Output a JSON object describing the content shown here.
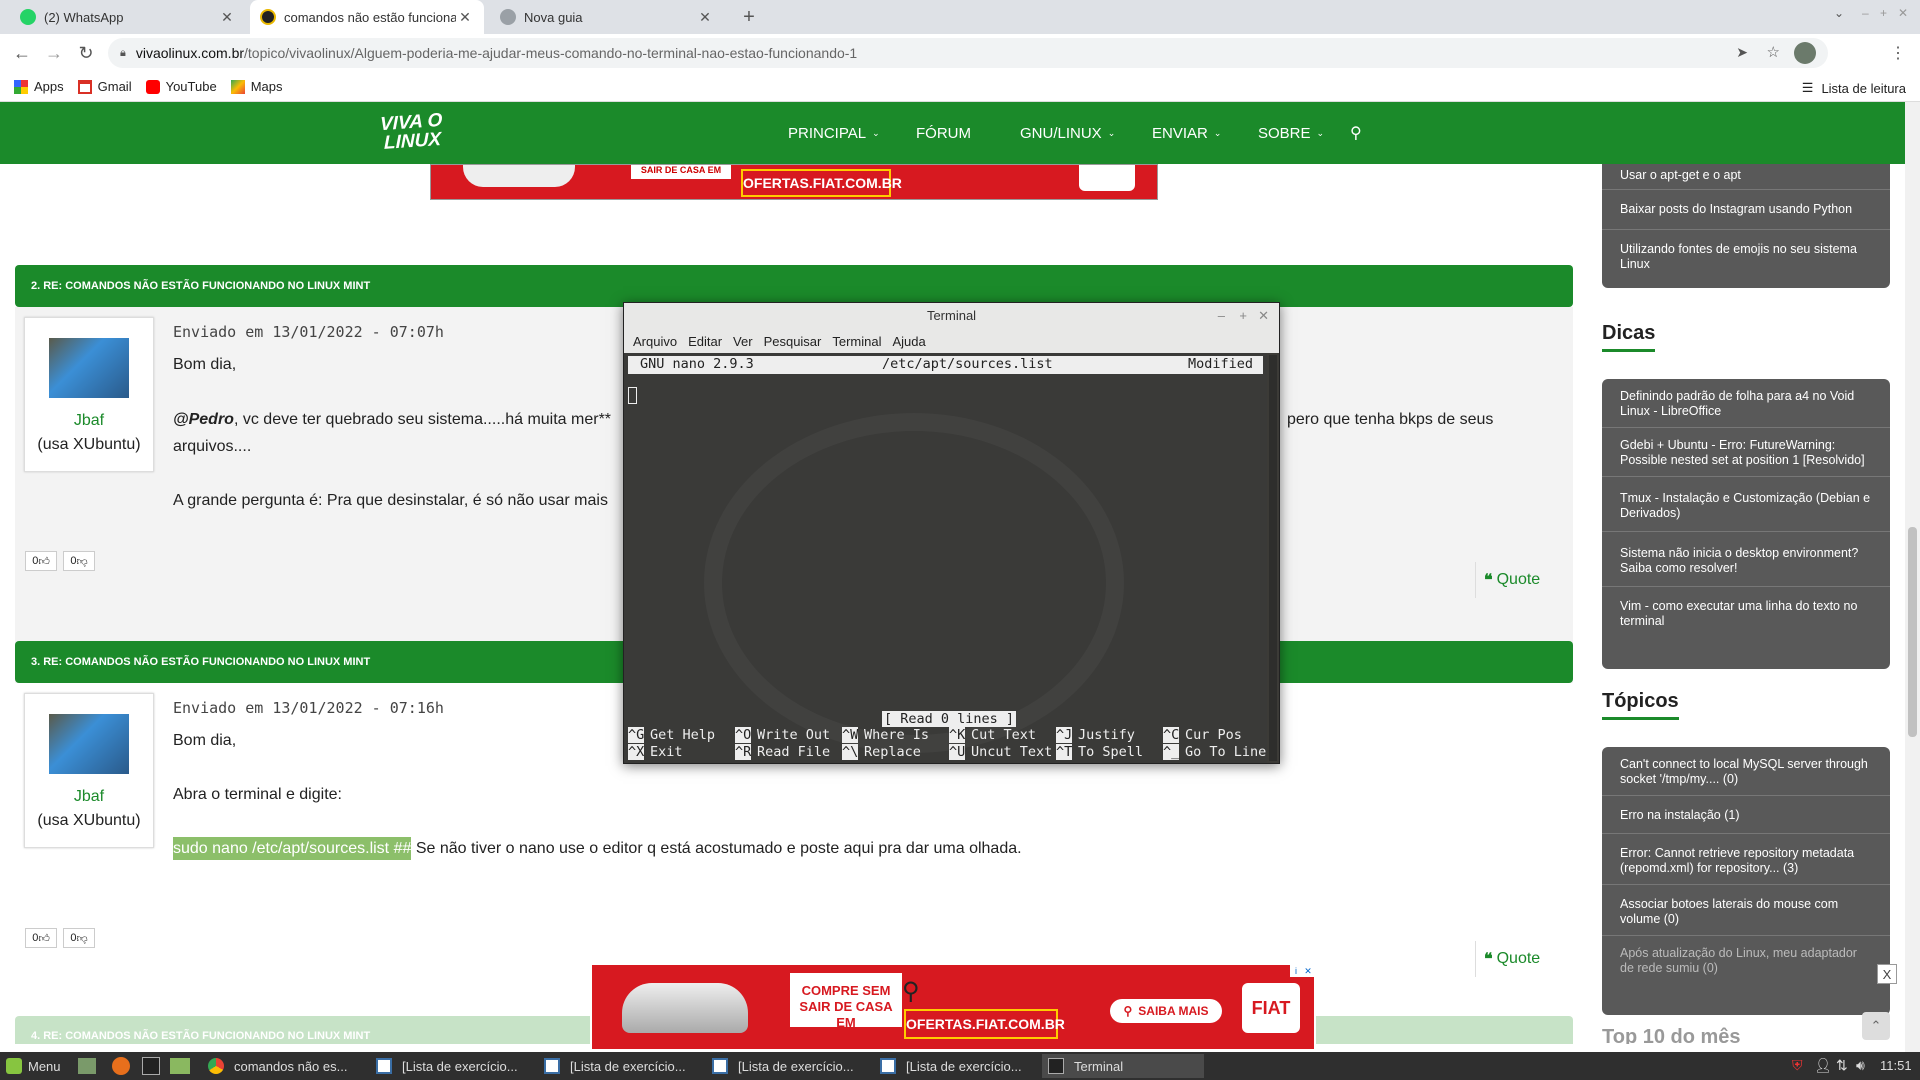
{
  "browser": {
    "tabs": [
      {
        "label": "(2) WhatsApp",
        "active": false
      },
      {
        "label": "comandos não estão funciona",
        "active": true
      },
      {
        "label": "Nova guia",
        "active": false
      }
    ],
    "new_tab": "+",
    "url_domain": "vivaolinux.com.br",
    "url_path": "/topico/vivaolinux/Alguem-poderia-me-ajudar-meus-comando-no-terminal-nao-estao-funcionando-1",
    "bookmarks": [
      "Apps",
      "Gmail",
      "YouTube",
      "Maps"
    ],
    "reading_list": "Lista de leitura"
  },
  "site": {
    "logo_line1": "VIVA O",
    "logo_line2": "LINUX",
    "menu": [
      {
        "label": "PRINCIPAL",
        "caret": "⌄"
      },
      {
        "label": "FÓRUM",
        "caret": ""
      },
      {
        "label": "GNU/LINUX",
        "caret": "⌄"
      },
      {
        "label": "ENVIAR",
        "caret": "⌄"
      },
      {
        "label": "SOBRE",
        "caret": "⌄"
      }
    ],
    "top_ad_text": "OFERTAS.FIAT.COM.BR",
    "top_ad_small": "SAIR DE CASA EM"
  },
  "posts": [
    {
      "header": "2. RE: COMANDOS NÃO ESTÃO FUNCIONANDO NO LINUX MINT",
      "user": "Jbaf",
      "distro": "(usa XUbuntu)",
      "meta": "Enviado em 13/01/2022 - 07:07h",
      "p1": "Bom dia,",
      "mention": "@Pedro",
      "p2a": ", vc deve ter quebrado seu sistema.....há muita mer**",
      "p2b": "pero que tenha bkps de seus",
      "p2c": "arquivos....",
      "p3": "A grande pergunta é: Pra que desinstalar, é só não usar mais",
      "up": "0",
      "down": "0",
      "quote": "Quote"
    },
    {
      "header": "3. RE: COMANDOS NÃO ESTÃO FUNCIONANDO NO LINUX MINT",
      "user": "Jbaf",
      "distro": "(usa XUbuntu)",
      "meta": "Enviado em 13/01/2022 - 07:16h",
      "p1": "Bom dia,",
      "p2": "Abra o terminal e digite:",
      "code": "sudo nano /etc/apt/sources.list ##",
      "p3": " Se não tiver o nano use o editor q está acostumado e poste aqui pra dar uma olhada.",
      "up": "0",
      "down": "0",
      "quote": "Quote"
    },
    {
      "header": "4. RE: COMANDOS NÃO ESTÃO FUNCIONANDO NO LINUX MINT"
    }
  ],
  "sidebar": {
    "top_items": [
      "Usar o apt-get e o apt",
      "Baixar posts do Instagram usando Python",
      "Utilizando fontes de emojis no seu sistema Linux"
    ],
    "dicas_title": "Dicas",
    "dicas": [
      "Definindo padrão de folha para a4 no Void Linux - LibreOffice",
      "Gdebi + Ubuntu - Erro: FutureWarning: Possible nested set at position 1 [Resolvido]",
      "Tmux - Instalação e Customização (Debian e Derivados)",
      "Sistema não inicia o desktop environment? Saiba como resolver!",
      "Vim - como executar uma linha do texto no terminal"
    ],
    "topicos_title": "Tópicos",
    "topicos": [
      "Can't connect to local MySQL server through socket '/tmp/my.... (0)",
      "Erro na instalação (1)",
      "Error: Cannot retrieve repository metadata (repomd.xml) for repository... (3)",
      "Associar botoes laterais do mouse com volume (0)",
      "Após atualização do Linux, meu adaptador de rede sumiu (0)"
    ],
    "top10_title": "Top 10 do mês"
  },
  "terminal": {
    "title": "Terminal",
    "menu": [
      "Arquivo",
      "Editar",
      "Ver",
      "Pesquisar",
      "Terminal",
      "Ajuda"
    ],
    "nano_version": "GNU nano 2.9.3",
    "file": "/etc/apt/sources.list",
    "state": "Modified",
    "status": "[ Read 0 lines ]",
    "shortcuts_row1": [
      [
        "^G",
        "Get Help"
      ],
      [
        "^O",
        "Write Out"
      ],
      [
        "^W",
        "Where Is"
      ],
      [
        "^K",
        "Cut Text"
      ],
      [
        "^J",
        "Justify"
      ],
      [
        "^C",
        "Cur Pos"
      ]
    ],
    "shortcuts_row2": [
      [
        "^X",
        "Exit"
      ],
      [
        "^R",
        "Read File"
      ],
      [
        "^\\",
        "Replace"
      ],
      [
        "^U",
        "Uncut Text"
      ],
      [
        "^T",
        "To Spell"
      ],
      [
        "^_",
        "Go To Line"
      ]
    ]
  },
  "bottom_ad": {
    "headline1": "COMPRE SEM",
    "headline2": "SAIR DE CASA EM",
    "site": "OFERTAS.FIAT.COM.BR",
    "cta": "SAIBA MAIS",
    "brand": "FIAT"
  },
  "taskbar": {
    "menu": "Menu",
    "tasks": [
      "comandos não es...",
      "[Lista de exercício...",
      "[Lista de exercício...",
      "[Lista de exercício...",
      "[Lista de exercício...",
      "Terminal"
    ],
    "clock": "11:51"
  }
}
